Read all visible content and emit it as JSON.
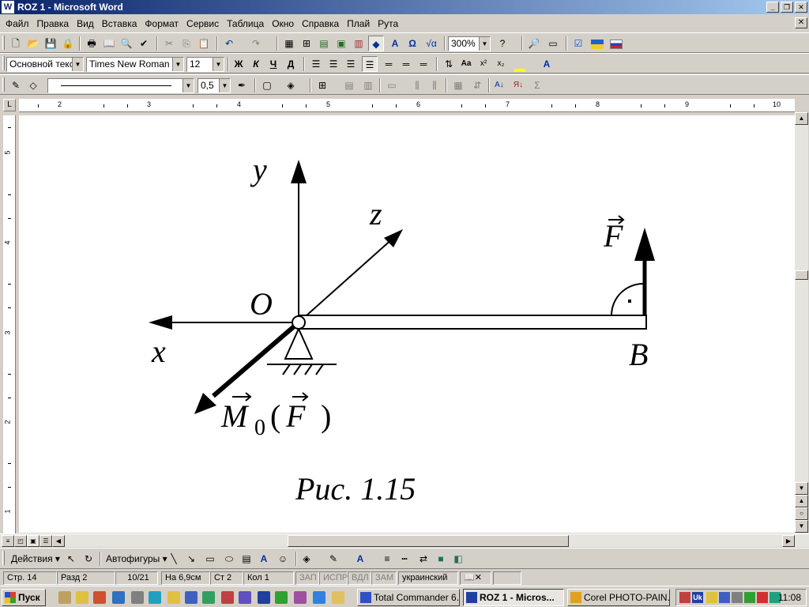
{
  "window": {
    "title": "ROZ 1 - Microsoft Word",
    "app_icon": "W",
    "buttons": [
      "_",
      "❐",
      "✕"
    ]
  },
  "menu": {
    "items": [
      "Файл",
      "Правка",
      "Вид",
      "Вставка",
      "Формат",
      "Сервис",
      "Таблица",
      "Окно",
      "Справка",
      "Плай",
      "Рута"
    ],
    "doc_close": "✕"
  },
  "standard_toolbar": {
    "zoom": "300%"
  },
  "formatting_toolbar": {
    "style": "Основной текст",
    "font": "Times New Roman",
    "size": "12",
    "bold": "Ж",
    "italic": "К",
    "underline": "Ч"
  },
  "drawing_line_toolbar": {
    "line_width": "0,5"
  },
  "ruler": {
    "h_numbers": [
      "2",
      "3",
      "4",
      "5",
      "6",
      "7",
      "8",
      "9",
      "10"
    ],
    "v_numbers": [
      "5",
      "4",
      "3",
      "2",
      "1"
    ]
  },
  "figure": {
    "label_y": "y",
    "label_z": "z",
    "label_x": "x",
    "label_o": "O",
    "label_b": "B",
    "label_f": "F",
    "label_m": "M",
    "label_m_sub": "0",
    "label_m_arg_open": "(",
    "label_m_arg": "F",
    "label_m_arg_close": ")",
    "caption": "Рис. 1.15"
  },
  "drawbar": {
    "actions": "Действия",
    "autoshapes": "Автофигуры"
  },
  "status": {
    "page": "Стр. 14",
    "section": "Разд 2",
    "pages": "10/21",
    "at": "На 6,9см",
    "line": "Ст 2",
    "col": "Кол 1",
    "rec": "ЗАП",
    "trk": "ИСПР",
    "ext": "ВДЛ",
    "ovr": "ЗАМ",
    "lang": "украинский"
  },
  "taskbar": {
    "start": "Пуск",
    "tasks": [
      "Total Commander 6...",
      "ROZ 1 - Micros...",
      "Corel PHOTO-PAIN..."
    ],
    "lang_indicator": "Uk",
    "clock": "11:08"
  },
  "colors": {
    "titlebar_start": "#0a246a",
    "titlebar_end": "#a6caf0",
    "chrome": "#d4d0c8"
  }
}
